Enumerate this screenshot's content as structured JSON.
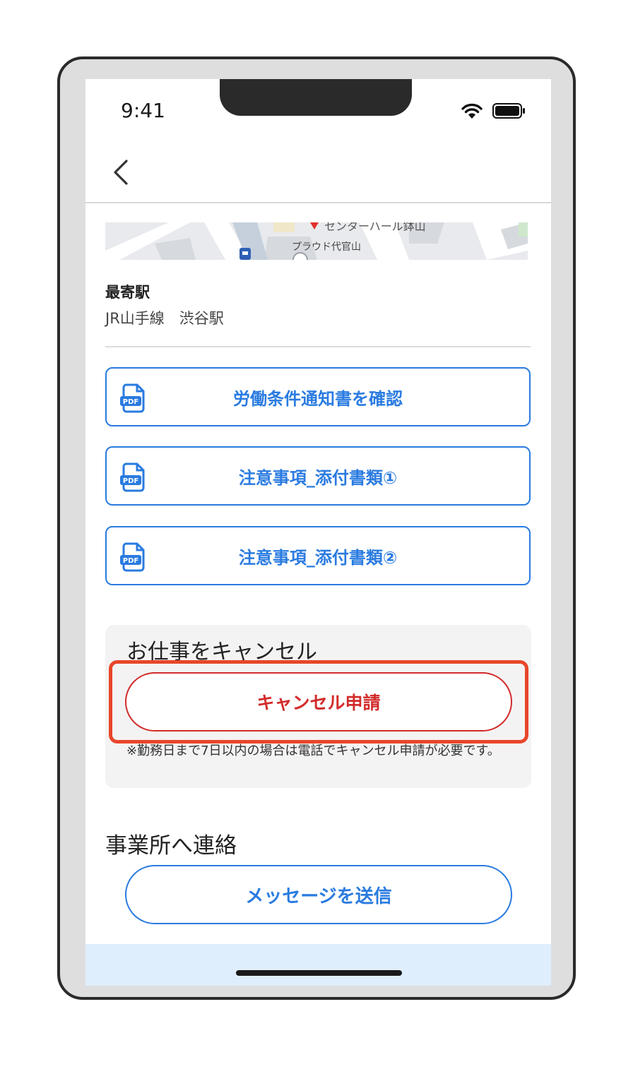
{
  "status_bar": {
    "time": "9:41"
  },
  "map": {
    "label_top": "センターハール鉢山",
    "label": "プラウド代官山"
  },
  "station": {
    "label": "最寄駅",
    "value": "JR山手線　渋谷駅"
  },
  "pdf_buttons": [
    {
      "label": "労働条件通知書を確認"
    },
    {
      "label": "注意事項_添付書類①"
    },
    {
      "label": "注意事項_添付書類②"
    }
  ],
  "cancel_section": {
    "title": "お仕事をキャンセル",
    "button_label": "キャンセル申請",
    "note": "※勤務日まで7日以内の場合は電話でキャンセル申請が必要です。"
  },
  "contact_section": {
    "title": "事業所へ連絡",
    "button_label": "メッセージを送信"
  },
  "colors": {
    "accent": "#2a7be0",
    "danger": "#d22b2b",
    "highlight": "#e8462a"
  }
}
